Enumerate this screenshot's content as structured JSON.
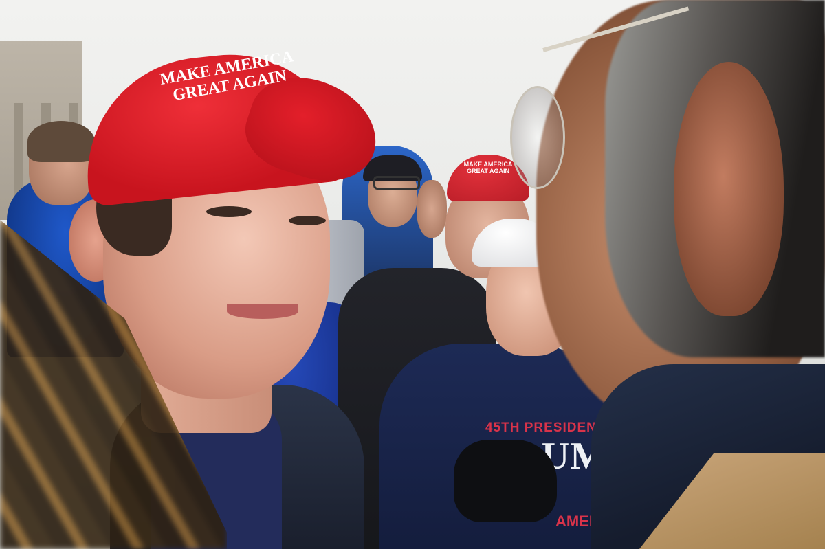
{
  "scene": {
    "description_icons": [
      "photo-scene"
    ],
    "colors": {
      "cap_red": "#d41e28",
      "sky": "#efefed",
      "hoodie_navy": "#1d2a55"
    }
  },
  "foreground_cap": {
    "line1": "MAKE AMERICA",
    "line2": "GREAT AGAIN"
  },
  "background_cap": {
    "line1": "MAKE AMERICA",
    "line2": "GREAT AGAIN"
  },
  "hoodie": {
    "line1": "45TH PRESIDENT",
    "line2": "TRUMP",
    "line3": "AMERICA"
  }
}
